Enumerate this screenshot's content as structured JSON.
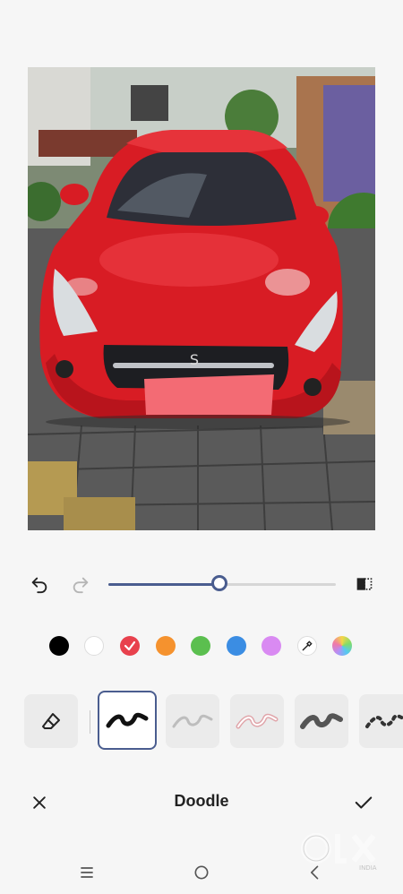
{
  "editor": {
    "title": "Doodle"
  },
  "colors": {
    "accent": "#4a5d8f",
    "palette": [
      {
        "name": "black",
        "hex": "#000000"
      },
      {
        "name": "white",
        "hex": "#ffffff"
      },
      {
        "name": "red",
        "hex": "#e8414d",
        "selected": true
      },
      {
        "name": "orange",
        "hex": "#f5922e"
      },
      {
        "name": "green",
        "hex": "#5bbf4f"
      },
      {
        "name": "blue",
        "hex": "#3b8de3"
      },
      {
        "name": "violet",
        "hex": "#d98af2"
      }
    ]
  },
  "brush_size": {
    "level": 0.49
  },
  "brushes": [
    {
      "name": "eraser"
    },
    {
      "name": "marker",
      "selected": true
    },
    {
      "name": "pencil"
    },
    {
      "name": "highlighter"
    },
    {
      "name": "crayon"
    },
    {
      "name": "dotted"
    }
  ],
  "watermark": {
    "brand": "OLX",
    "sub": "INDIA"
  }
}
